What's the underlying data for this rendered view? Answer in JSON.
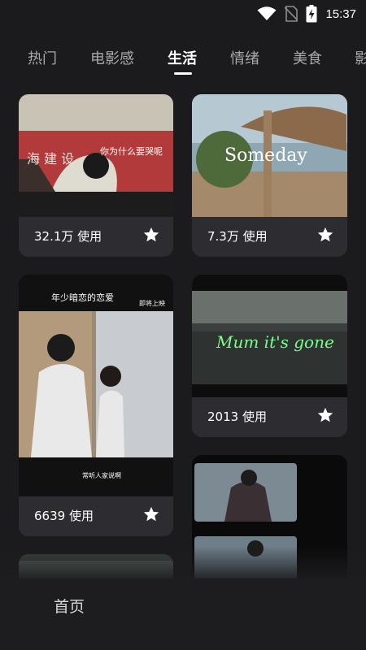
{
  "status": {
    "time": "15:37"
  },
  "tabs": [
    {
      "label": "热门"
    },
    {
      "label": "电影感"
    },
    {
      "label": "生活"
    },
    {
      "label": "情绪"
    },
    {
      "label": "美食"
    },
    {
      "label": "影"
    }
  ],
  "active_tab": "生活",
  "cards": [
    {
      "usage": "32.1万 使用",
      "overlay_text": "你为什么要哭呢",
      "banner_text": "海 建 设"
    },
    {
      "usage": "7.3万 使用",
      "overlay_text": "Someday"
    },
    {
      "usage": "6639 使用",
      "overlay_text": "年少暗恋的恋爱",
      "top_right_text": "即将上映",
      "caption": "常听人家说啊"
    },
    {
      "usage": "2013 使用",
      "overlay_text": "Mum it's gone"
    }
  ],
  "bottom_nav": {
    "home_label": "首页"
  },
  "colors": {
    "background": "#1b1b1d",
    "card": "#2d2d31",
    "active_tab": "#ffffff",
    "inactive_tab": "#a8a8ac"
  }
}
